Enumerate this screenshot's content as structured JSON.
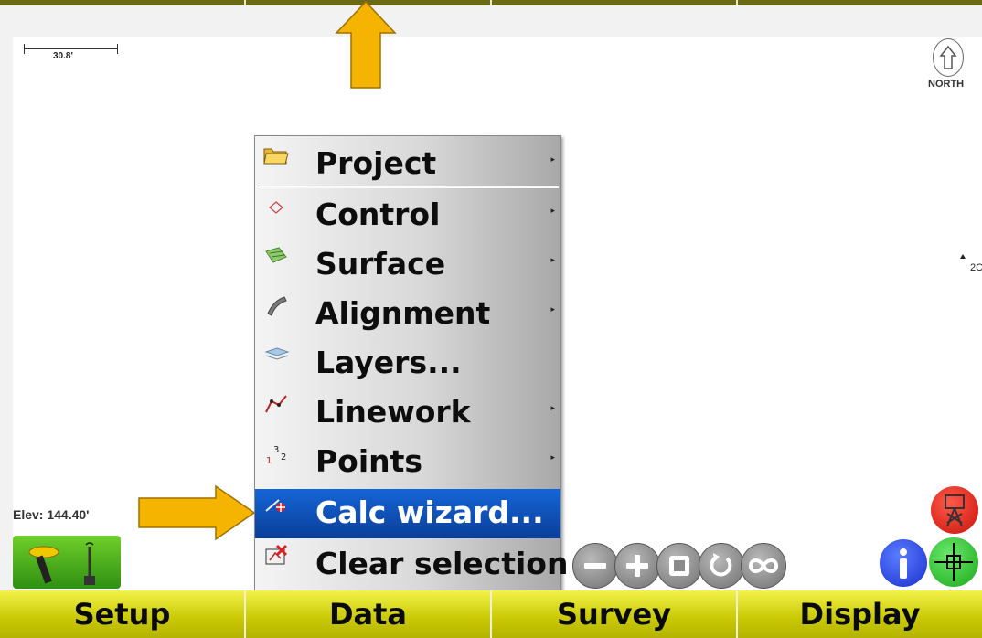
{
  "map": {
    "scale_label": "30.8'",
    "north_label": "NORTH",
    "point_label": "2C"
  },
  "status": {
    "elevation": "Elev: 144.40'"
  },
  "data_menu": {
    "items": [
      {
        "label": "Project",
        "icon": "folder-icon",
        "submenu": true
      },
      {
        "label": "Control",
        "icon": "control-point-icon",
        "submenu": true
      },
      {
        "label": "Surface",
        "icon": "surface-icon",
        "submenu": true
      },
      {
        "label": "Alignment",
        "icon": "alignment-icon",
        "submenu": true
      },
      {
        "label": "Layers...",
        "icon": "layers-icon",
        "submenu": false
      },
      {
        "label": "Linework",
        "icon": "linework-icon",
        "submenu": true
      },
      {
        "label": "Points",
        "icon": "points-icon",
        "submenu": true
      },
      {
        "label": "Calc wizard...",
        "icon": "calc-wizard-icon",
        "submenu": false,
        "selected": true
      },
      {
        "label": "Clear selection",
        "icon": "clear-selection-icon",
        "submenu": false
      }
    ]
  },
  "zoom_controls": [
    "zoom-out-icon",
    "zoom-in-icon",
    "zoom-extents-icon",
    "rotate-icon",
    "zoom-all-icon"
  ],
  "bottom_nav": {
    "setup": "Setup",
    "data": "Data",
    "survey": "Survey",
    "display": "Display"
  },
  "colors": {
    "menu_selected": "#0a4fb8",
    "nav_bar": "#d6d610",
    "annotation_arrow": "#f5b400"
  }
}
